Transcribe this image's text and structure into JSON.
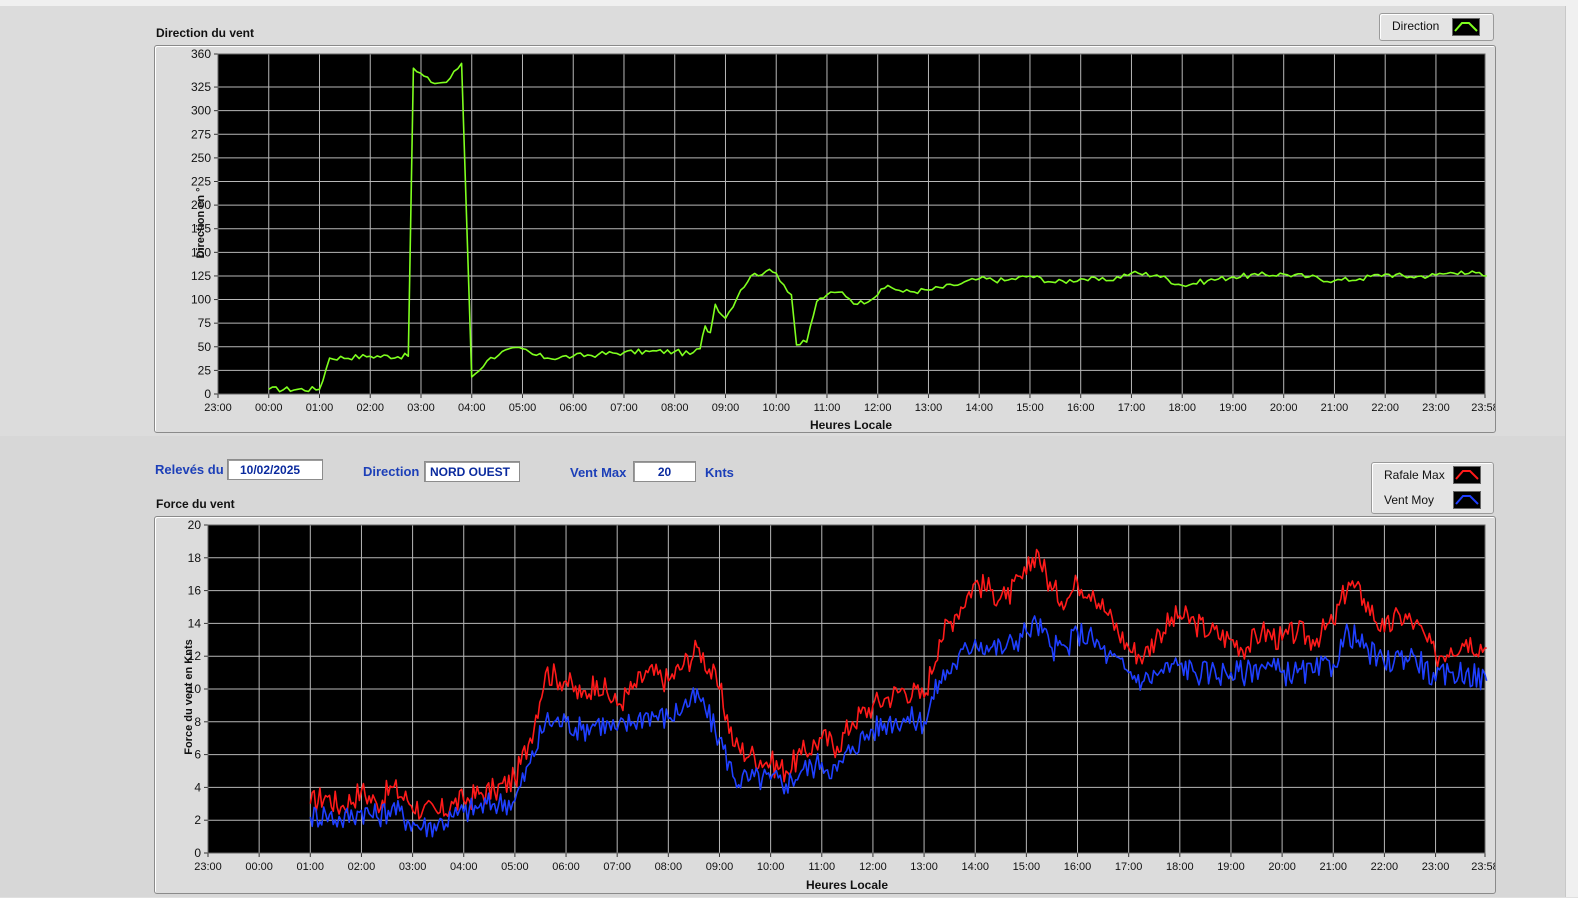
{
  "colors": {
    "direction_line": "#7fff1f",
    "rafale_line": "#ff1a1a",
    "moy_line": "#1f3fff",
    "plot_bg": "#000000",
    "grid": "#b8b8b8",
    "label_blue": "#1c3fb8"
  },
  "controls": {
    "releves_label": "Relevés du",
    "releves_value": "10/02/2025",
    "direction_label": "Direction",
    "direction_value": "NORD OUEST",
    "ventmax_label": "Vent Max",
    "ventmax_value": "20",
    "ventmax_unit": "Knts"
  },
  "chart_data": [
    {
      "type": "line",
      "title": "Direction du vent",
      "xlabel": "Heures Locale",
      "ylabel": "Direction en °",
      "x_ticks": [
        "23:00",
        "00:00",
        "01:00",
        "02:00",
        "03:00",
        "04:00",
        "05:00",
        "06:00",
        "07:00",
        "08:00",
        "09:00",
        "10:00",
        "11:00",
        "12:00",
        "13:00",
        "14:00",
        "15:00",
        "16:00",
        "17:00",
        "18:00",
        "19:00",
        "20:00",
        "21:00",
        "22:00",
        "23:00",
        "23:58"
      ],
      "y_ticks": [
        0,
        25,
        50,
        75,
        100,
        125,
        150,
        175,
        200,
        225,
        250,
        275,
        300,
        325,
        360
      ],
      "ylim": [
        0,
        360
      ],
      "grid": true,
      "legend": {
        "position": "top-right",
        "entries": [
          "Direction"
        ]
      },
      "series": [
        {
          "name": "Direction",
          "x": [
            0.0,
            1.0,
            1.2,
            2.0,
            2.75,
            2.85,
            3.2,
            3.5,
            3.8,
            4.0,
            4.3,
            4.6,
            5.0,
            5.2,
            5.5,
            6.0,
            6.5,
            7.0,
            7.5,
            8.0,
            8.3,
            8.5,
            8.6,
            8.7,
            8.8,
            9.0,
            9.3,
            9.5,
            9.8,
            10.0,
            10.3,
            10.4,
            10.6,
            10.8,
            11.0,
            11.3,
            11.6,
            12.0,
            12.2,
            12.5,
            13.0,
            13.5,
            14.0,
            14.5,
            15.0,
            15.5,
            16.0,
            16.5,
            17.0,
            17.5,
            18.0,
            18.5,
            19.0,
            19.5,
            20.0,
            20.5,
            21.0,
            21.5,
            22.0,
            22.5,
            23.0,
            23.5,
            24.0
          ],
          "y": [
            5,
            5,
            38,
            40,
            40,
            345,
            330,
            330,
            350,
            18,
            35,
            45,
            48,
            42,
            38,
            40,
            42,
            44,
            45,
            45,
            42,
            48,
            72,
            65,
            95,
            80,
            110,
            125,
            130,
            128,
            105,
            52,
            55,
            98,
            105,
            108,
            95,
            105,
            115,
            108,
            110,
            115,
            122,
            120,
            125,
            118,
            122,
            120,
            128,
            126,
            115,
            120,
            124,
            126,
            127,
            124,
            120,
            122,
            127,
            124,
            126,
            130,
            125
          ]
        }
      ]
    },
    {
      "type": "line",
      "title": "Force du vent",
      "xlabel": "Heures Locale",
      "ylabel": "Force du vent en Knts",
      "x_ticks": [
        "23:00",
        "00:00",
        "01:00",
        "02:00",
        "03:00",
        "04:00",
        "05:00",
        "06:00",
        "07:00",
        "08:00",
        "09:00",
        "10:00",
        "11:00",
        "12:00",
        "13:00",
        "14:00",
        "15:00",
        "16:00",
        "17:00",
        "18:00",
        "19:00",
        "20:00",
        "21:00",
        "22:00",
        "23:00",
        "23:58"
      ],
      "y_ticks": [
        0,
        2,
        4,
        6,
        8,
        10,
        12,
        14,
        16,
        18,
        20
      ],
      "ylim": [
        0,
        20
      ],
      "grid": true,
      "legend": {
        "position": "top-right",
        "entries": [
          "Rafale Max",
          "Vent Moy"
        ]
      },
      "series": [
        {
          "name": "Rafale Max",
          "x": [
            1.0,
            1.3,
            1.6,
            2.0,
            2.3,
            2.6,
            2.9,
            3.2,
            3.5,
            3.8,
            4.0,
            4.3,
            4.6,
            5.0,
            5.3,
            5.6,
            6.0,
            6.3,
            6.6,
            7.0,
            7.3,
            7.6,
            8.0,
            8.3,
            8.6,
            9.0,
            9.3,
            9.6,
            10.0,
            10.3,
            10.6,
            11.0,
            11.3,
            11.6,
            12.0,
            12.3,
            12.6,
            13.0,
            13.3,
            13.6,
            14.0,
            14.3,
            14.6,
            15.0,
            15.2,
            15.5,
            15.8,
            16.0,
            16.3,
            16.6,
            17.0,
            17.3,
            17.6,
            18.0,
            18.3,
            18.6,
            19.0,
            19.3,
            19.6,
            20.0,
            20.3,
            20.6,
            21.0,
            21.3,
            21.6,
            22.0,
            22.3,
            22.6,
            23.0,
            23.3,
            23.6,
            24.0
          ],
          "y": [
            3.0,
            3.5,
            2.8,
            3.8,
            3.0,
            4.0,
            3.2,
            2.6,
            2.4,
            3.0,
            3.2,
            3.6,
            3.8,
            4.5,
            7.0,
            11.0,
            10.5,
            9.5,
            10.5,
            9.0,
            10.0,
            11.0,
            10.5,
            11.5,
            12.5,
            10.0,
            6.5,
            6.0,
            5.5,
            5.0,
            6.0,
            7.0,
            6.5,
            8.0,
            9.0,
            9.5,
            10.0,
            9.5,
            13.0,
            14.5,
            16.5,
            16.0,
            15.5,
            17.0,
            18.5,
            16.0,
            15.5,
            16.5,
            16.0,
            14.5,
            12.5,
            12.0,
            13.5,
            14.5,
            14.0,
            13.5,
            13.0,
            12.5,
            13.5,
            13.0,
            13.5,
            13.0,
            14.0,
            16.5,
            15.5,
            13.5,
            14.5,
            14.0,
            12.0,
            12.5,
            13.0,
            12.5
          ],
          "color": "#ff1a1a"
        },
        {
          "name": "Vent Moy",
          "x": [
            1.0,
            1.3,
            1.6,
            2.0,
            2.3,
            2.6,
            2.9,
            3.2,
            3.5,
            3.8,
            4.0,
            4.3,
            4.6,
            5.0,
            5.3,
            5.6,
            6.0,
            6.3,
            6.6,
            7.0,
            7.3,
            7.6,
            8.0,
            8.3,
            8.6,
            9.0,
            9.3,
            9.6,
            10.0,
            10.3,
            10.6,
            11.0,
            11.3,
            11.6,
            12.0,
            12.3,
            12.6,
            13.0,
            13.3,
            13.6,
            14.0,
            14.3,
            14.6,
            15.0,
            15.2,
            15.5,
            15.8,
            16.0,
            16.3,
            16.6,
            17.0,
            17.3,
            17.6,
            18.0,
            18.3,
            18.6,
            19.0,
            19.3,
            19.6,
            20.0,
            20.3,
            20.6,
            21.0,
            21.3,
            21.6,
            22.0,
            22.3,
            22.6,
            23.0,
            23.3,
            23.6,
            24.0
          ],
          "y": [
            2.2,
            2.4,
            2.0,
            2.6,
            2.2,
            2.8,
            2.0,
            1.6,
            1.8,
            2.2,
            2.5,
            2.8,
            3.0,
            3.2,
            5.5,
            8.0,
            8.0,
            7.5,
            8.0,
            7.5,
            8.0,
            8.5,
            8.2,
            9.0,
            9.5,
            7.0,
            4.5,
            4.5,
            4.5,
            4.2,
            5.0,
            5.5,
            5.0,
            6.5,
            7.5,
            8.0,
            8.2,
            8.0,
            10.5,
            11.5,
            13.0,
            12.5,
            12.5,
            13.5,
            14.0,
            12.5,
            12.5,
            13.5,
            13.0,
            12.0,
            11.0,
            10.5,
            11.0,
            11.5,
            11.0,
            11.0,
            11.0,
            11.0,
            11.5,
            11.0,
            11.0,
            11.0,
            11.5,
            13.5,
            12.5,
            11.5,
            12.0,
            12.0,
            10.5,
            11.0,
            11.0,
            10.5
          ],
          "color": "#1f3fff"
        }
      ]
    }
  ]
}
